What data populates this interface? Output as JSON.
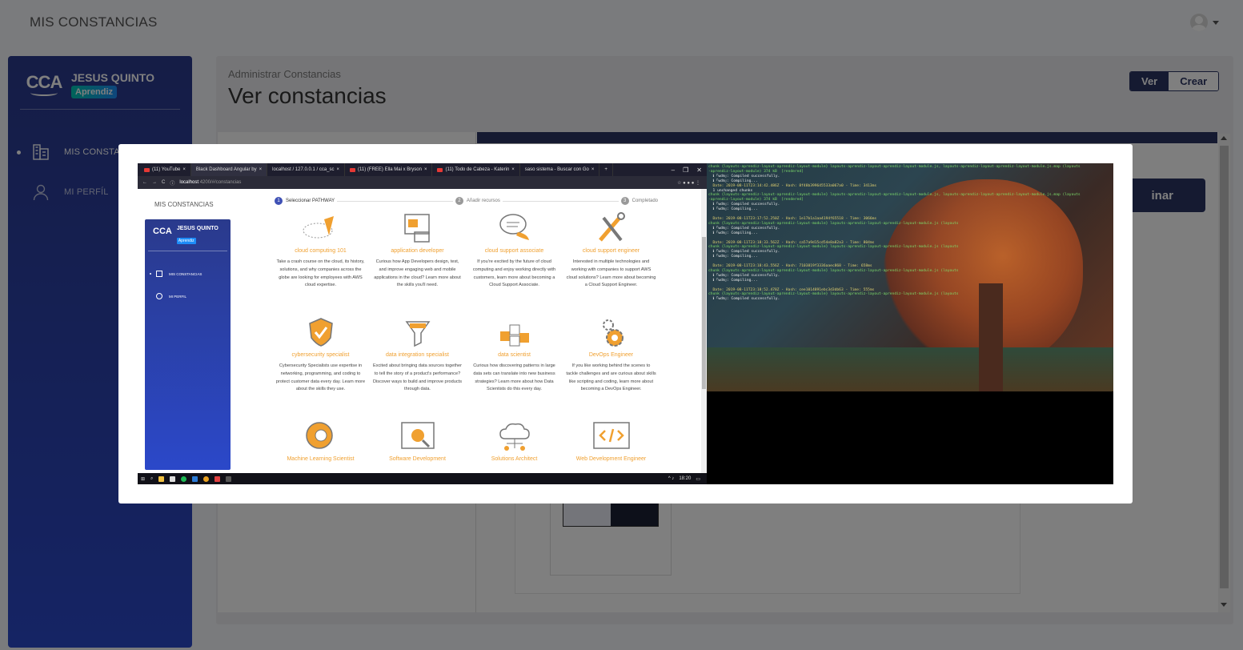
{
  "topbar": {
    "brand": "MIS CONSTANCIAS"
  },
  "sidebar": {
    "logo_text": "CCA",
    "user_name": "JESUS QUINTO",
    "role_badge": "Aprendiz",
    "items": [
      {
        "label": "MIS CONSTANCIAS",
        "icon": "building-icon",
        "active": true
      },
      {
        "label": "MI PERFÍL",
        "icon": "user-icon",
        "active": false
      }
    ]
  },
  "main": {
    "subtitle": "Administrar Constancias",
    "title": "Ver constancias",
    "toggle": {
      "ver": "Ver",
      "crear": "Crear"
    },
    "action_button_visible": "inar"
  },
  "modal": {
    "browser": {
      "tabs": [
        "(11) YouTube",
        "Black Dashboard Angular by",
        "localhost / 127.0.0.1 / cca_sc",
        "(11) (FREE) Ella Mai x Bryson",
        "(11) Todo de Cabeza - Katerin",
        "saso sistema - Buscar con Go"
      ],
      "url_host": "localhost",
      "url_path": ":4200/#/constancias",
      "mini_brand": "MIS CONSTANCIAS",
      "mini_logo": "CCA",
      "mini_user": "JESUS QUINTO",
      "mini_badge": "Aprendiz",
      "mini_items": [
        "MIS CONSTANCIAS",
        "MI PERFIL"
      ],
      "steps": [
        {
          "num": "1",
          "label": "Seleccionar PATHWAY"
        },
        {
          "num": "2",
          "label": "Añadir recursos"
        },
        {
          "num": "3",
          "label": "Completado"
        }
      ],
      "pathways": [
        {
          "title": "cloud computing 101",
          "icon": "good-place-to-start-icon",
          "desc": "Take a crash course on the cloud, its history, solutions, and why companies across the globe are looking for employees with AWS cloud expertise."
        },
        {
          "title": "application developer",
          "icon": "app-window-icon",
          "desc": "Curious how App Developers design, test, and improve engaging web and mobile applications in the cloud? Learn more about the skills you'll need."
        },
        {
          "title": "cloud support associate",
          "icon": "chat-bubble-icon",
          "desc": "If you're excited by the future of cloud computing and enjoy working directly with customers, learn more about becoming a Cloud Support Associate."
        },
        {
          "title": "cloud support engineer",
          "icon": "wrench-screwdriver-icon",
          "desc": "Interested in multiple technologies and working with companies to support AWS cloud solutions? Learn more about becoming a Cloud Support Engineer."
        },
        {
          "title": "cybersecurity specialist",
          "icon": "shield-check-icon",
          "desc": "Cybersecurity Specialists use expertise in networking, programming, and coding to protect customer data every day. Learn more about the skills they use."
        },
        {
          "title": "data integration specialist",
          "icon": "funnel-icon",
          "desc": "Excited about bringing data sources together to tell the story of a product's performance? Discover ways to build and improve products through data."
        },
        {
          "title": "data scientist",
          "icon": "data-cubes-icon",
          "desc": "Curious how discovering patterns in large data sets can translate into new business strategies? Learn more about how Data Scientists do this every day."
        },
        {
          "title": "DevOps Engineer",
          "icon": "gears-icon",
          "desc": "If you like working behind the scenes to tackle challenges and are curious about skills like scripting and coding, learn more about becoming a DevOps Engineer."
        },
        {
          "title": "Machine Learning Scientist",
          "icon": "brain-gear-icon",
          "desc": ""
        },
        {
          "title": "Software Development",
          "icon": "code-search-icon",
          "desc": ""
        },
        {
          "title": "Solutions Architect",
          "icon": "cloud-network-icon",
          "desc": ""
        },
        {
          "title": "Web Development Engineer",
          "icon": "code-brackets-icon",
          "desc": ""
        }
      ],
      "taskbar_time": "18:20"
    },
    "terminal_lines": [
      "chunk {layouts-aprendiz-layout-aprendiz-layout-module} layouts-aprendiz-layout-aprendiz-layout-module.js, layouts-aprendiz-layout-aprendiz-layout-module.js.map (layouts",
      "-aprendiz-layout-module) 374 kB  [rendered]",
      "  Date: 2019-08-11T23:14:42.486Z - Hash: 8f48b399645533a067a0 - Time: 3413ms",
      "  1 unchanged chunks",
      "chunk {layouts-aprendiz-layout-aprendiz-layout-module} layouts-aprendiz-layout-aprendiz-layout-module.js, layouts-aprendiz-layout-aprendiz-layout-module.js.map (layouts",
      "-aprendiz-layout-module) 374 kB  [rendered]",
      "  Date: 2019-08-11T23:17:52.250Z - Hash: 1e17b1a1aa4194f65518 - Time: 3066ms",
      "  Date: 2019-08-11T23:18:33.562Z - Hash: ca57a9d15cd54e8a82a3 - Time: 804ms",
      "  Date: 2019-08-11T23:18:43.556Z - Hash: 7103819f3336aaec868 - Time: 658ms",
      "  Date: 2019-08-11T23:18:52.478Z - Hash: cee1014891ebc3d3db63 - Time: 555ms"
    ]
  }
}
